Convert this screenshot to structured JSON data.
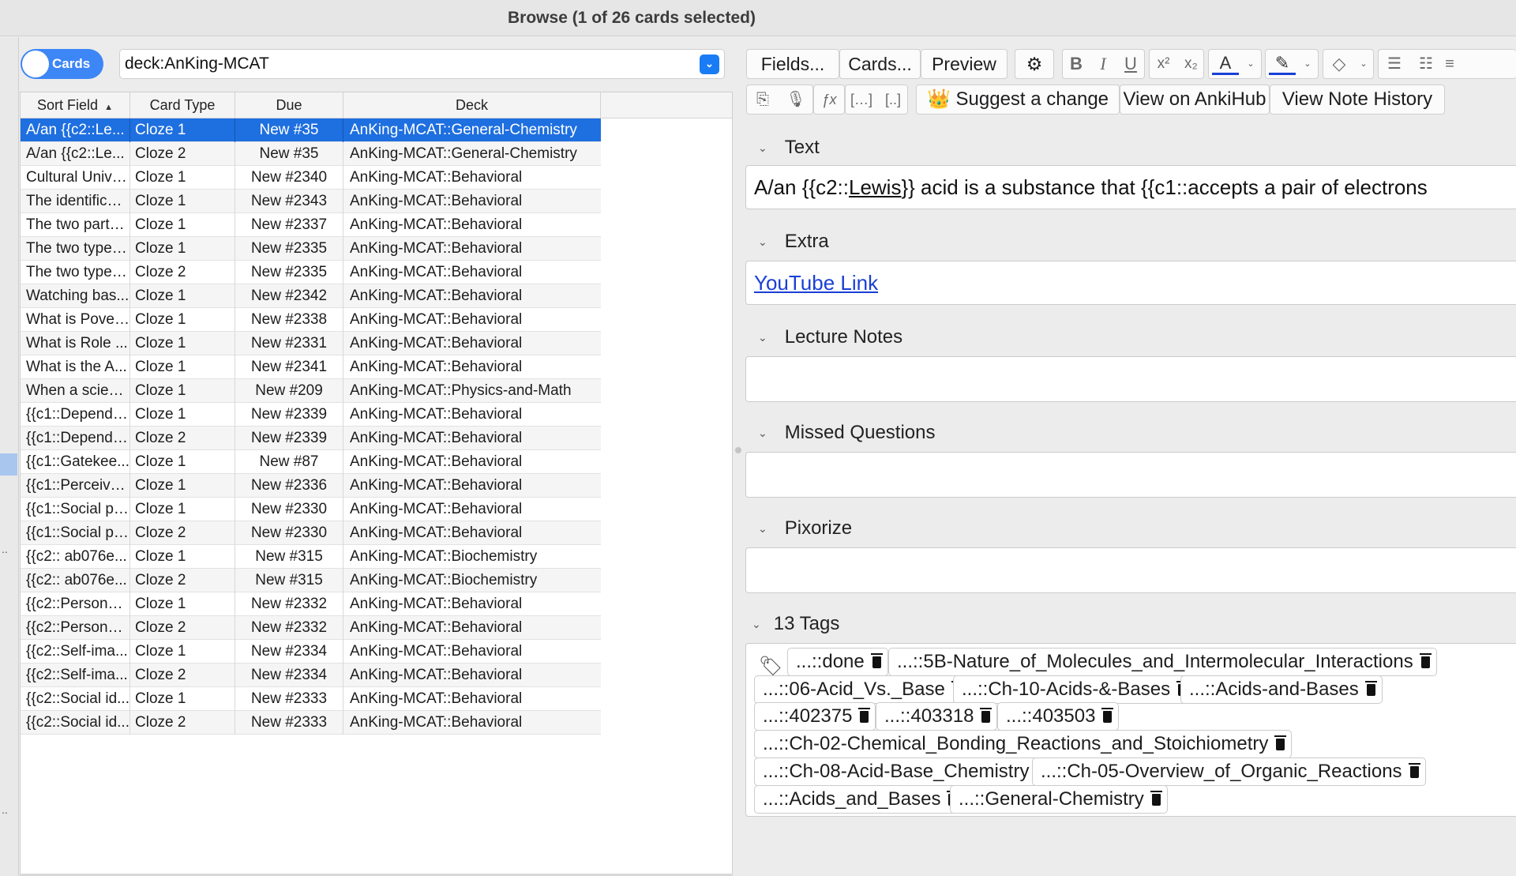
{
  "window": {
    "title": "Browse (1 of 26 cards selected)"
  },
  "search": {
    "toggle_label": "Cards",
    "query": "deck:AnKing-MCAT"
  },
  "table": {
    "columns": [
      "Sort Field",
      "Card Type",
      "Due",
      "Deck"
    ],
    "rows": [
      {
        "sort": "A/an {{c2::Le...",
        "type": "Cloze 1",
        "due": "New #35",
        "deck": "AnKing-MCAT::General-Chemistry"
      },
      {
        "sort": "A/an {{c2::Le...",
        "type": "Cloze 2",
        "due": "New #35",
        "deck": "AnKing-MCAT::General-Chemistry"
      },
      {
        "sort": "Cultural Unive...",
        "type": "Cloze 1",
        "due": "New #2340",
        "deck": "AnKing-MCAT::Behavioral"
      },
      {
        "sort": "The identificat...",
        "type": "Cloze 1",
        "due": "New #2343",
        "deck": "AnKing-MCAT::Behavioral"
      },
      {
        "sort": "The two parts ...",
        "type": "Cloze 1",
        "due": "New #2337",
        "deck": "AnKing-MCAT::Behavioral"
      },
      {
        "sort": "The two types...",
        "type": "Cloze 1",
        "due": "New #2335",
        "deck": "AnKing-MCAT::Behavioral"
      },
      {
        "sort": "The two types...",
        "type": "Cloze 2",
        "due": "New #2335",
        "deck": "AnKing-MCAT::Behavioral"
      },
      {
        "sort": "Watching bas...",
        "type": "Cloze 1",
        "due": "New #2342",
        "deck": "AnKing-MCAT::Behavioral"
      },
      {
        "sort": "What is Pover...",
        "type": "Cloze 1",
        "due": "New #2338",
        "deck": "AnKing-MCAT::Behavioral"
      },
      {
        "sort": "What is Role ...",
        "type": "Cloze 1",
        "due": "New #2331",
        "deck": "AnKing-MCAT::Behavioral"
      },
      {
        "sort": "What is the A...",
        "type": "Cloze 1",
        "due": "New #2341",
        "deck": "AnKing-MCAT::Behavioral"
      },
      {
        "sort": "When a scient...",
        "type": "Cloze 1",
        "due": "New #209",
        "deck": "AnKing-MCAT::Physics-and-Math"
      },
      {
        "sort": "{{c1::Depende...",
        "type": "Cloze 1",
        "due": "New #2339",
        "deck": "AnKing-MCAT::Behavioral"
      },
      {
        "sort": "{{c1::Depende...",
        "type": "Cloze 2",
        "due": "New #2339",
        "deck": "AnKing-MCAT::Behavioral"
      },
      {
        "sort": "{{c1::Gatekee...",
        "type": "Cloze 1",
        "due": "New #87",
        "deck": "AnKing-MCAT::Behavioral"
      },
      {
        "sort": "{{c1::Perceive...",
        "type": "Cloze 1",
        "due": "New #2336",
        "deck": "AnKing-MCAT::Behavioral"
      },
      {
        "sort": "{{c1::Social ph...",
        "type": "Cloze 1",
        "due": "New #2330",
        "deck": "AnKing-MCAT::Behavioral"
      },
      {
        "sort": "{{c1::Social ph...",
        "type": "Cloze 2",
        "due": "New #2330",
        "deck": "AnKing-MCAT::Behavioral"
      },
      {
        "sort": "{{c2:: ab076e...",
        "type": "Cloze 1",
        "due": "New #315",
        "deck": "AnKing-MCAT::Biochemistry"
      },
      {
        "sort": "{{c2:: ab076e...",
        "type": "Cloze 2",
        "due": "New #315",
        "deck": "AnKing-MCAT::Biochemistry"
      },
      {
        "sort": "{{c2::Personal...",
        "type": "Cloze 1",
        "due": "New #2332",
        "deck": "AnKing-MCAT::Behavioral"
      },
      {
        "sort": "{{c2::Personal...",
        "type": "Cloze 2",
        "due": "New #2332",
        "deck": "AnKing-MCAT::Behavioral"
      },
      {
        "sort": "{{c2::Self-ima...",
        "type": "Cloze 1",
        "due": "New #2334",
        "deck": "AnKing-MCAT::Behavioral"
      },
      {
        "sort": "{{c2::Self-ima...",
        "type": "Cloze 2",
        "due": "New #2334",
        "deck": "AnKing-MCAT::Behavioral"
      },
      {
        "sort": "{{c2::Social id...",
        "type": "Cloze 1",
        "due": "New #2333",
        "deck": "AnKing-MCAT::Behavioral"
      },
      {
        "sort": "{{c2::Social id...",
        "type": "Cloze 2",
        "due": "New #2333",
        "deck": "AnKing-MCAT::Behavioral"
      }
    ]
  },
  "editor_toolbar": {
    "fields_label": "Fields...",
    "cards_label": "Cards...",
    "preview_label": "Preview",
    "bold": "B",
    "italic": "I",
    "underline": "U",
    "suggest_emoji": "👑",
    "suggest_label": "Suggest a change",
    "ankihub_label": "View on AnkiHub",
    "history_label": "View Note History"
  },
  "fields": {
    "text_label": "Text",
    "text_pre": "A/an {{c2::",
    "text_underlined": "Lewis",
    "text_post": "}} acid is a substance that {{c1::accepts a pair of electrons",
    "extra_label": "Extra",
    "extra_link": "YouTube Link",
    "lecture_label": "Lecture Notes",
    "missed_label": "Missed Questions",
    "pixorize_label": "Pixorize"
  },
  "tags": {
    "header": "13 Tags",
    "items": [
      "...::done",
      "...::5B-Nature_of_Molecules_and_Intermolecular_Interactions",
      "...::06-Acid_Vs._Base",
      "...::Ch-10-Acids-&-Bases",
      "...::Acids-and-Bases",
      "...::402375",
      "...::403318",
      "...::403503",
      "...::Ch-02-Chemical_Bonding_Reactions_and_Stoichiometry",
      "...::Ch-08-Acid-Base_Chemistry",
      "...::Ch-05-Overview_of_Organic_Reactions",
      "...::Acids_and_Bases",
      "...::General-Chemistry"
    ]
  },
  "colors": {
    "accent": "#1e6fe0",
    "toggle": "#3d86f5",
    "link": "#1a3fd6",
    "font_color_bar": "#1a3fd6"
  }
}
